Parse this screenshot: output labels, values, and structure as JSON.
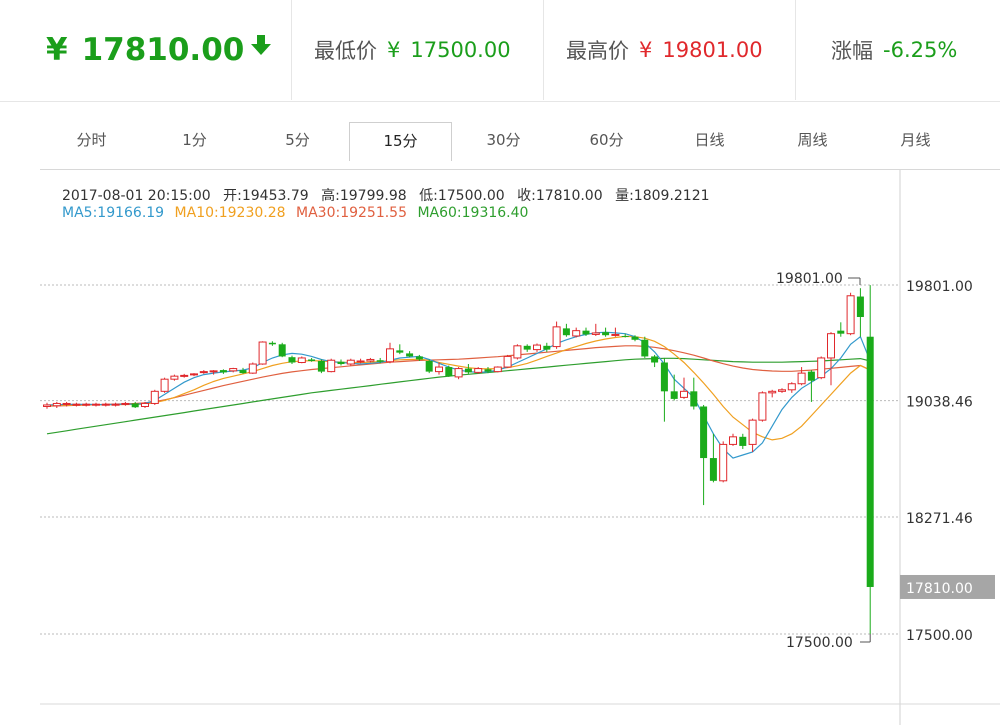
{
  "header": {
    "currency": "¥",
    "current_price": "17810.00",
    "current_direction": "down",
    "low_label": "最低价",
    "low_currency": "¥",
    "low_price": "17500.00",
    "high_label": "最高价",
    "high_currency": "¥",
    "high_price": "19801.00",
    "change_label": "涨幅",
    "change_value": "-6.25%"
  },
  "tabs": [
    {
      "label": "分时",
      "active": false
    },
    {
      "label": "1分",
      "active": false
    },
    {
      "label": "5分",
      "active": false
    },
    {
      "label": "15分",
      "active": true
    },
    {
      "label": "30分",
      "active": false
    },
    {
      "label": "60分",
      "active": false
    },
    {
      "label": "日线",
      "active": false
    },
    {
      "label": "周线",
      "active": false
    },
    {
      "label": "月线",
      "active": false
    }
  ],
  "info": {
    "datetime": "2017-08-01 20:15:00",
    "open": "开:19453.79",
    "high": "高:19799.98",
    "low": "低:17500.00",
    "close": "收:17810.00",
    "volume": "量:1809.2121"
  },
  "ma_legend": {
    "ma5": "MA5:19166.19",
    "ma10": "MA10:19230.28",
    "ma30": "MA30:19251.55",
    "ma60": "MA60:19316.40"
  },
  "colors": {
    "up": "#e0282c",
    "down": "#1aab1a",
    "ma5": "#3399cc",
    "ma10": "#f0a020",
    "ma30": "#e06040",
    "ma60": "#2e9e2e",
    "grid": "#bbbbbb"
  },
  "chart_data": {
    "type": "candlestick",
    "y_axis_ticks": [
      "19801.00",
      "19038.46",
      "18271.46",
      "17500.00"
    ],
    "ylim": [
      17300,
      20080
    ],
    "current_price_label": "17810.00",
    "annotations": {
      "max": "19801.00",
      "min": "17500.00"
    },
    "candles": [
      [
        19000,
        19010,
        18985,
        19025
      ],
      [
        19005,
        19020,
        18990,
        19030
      ],
      [
        19015,
        19020,
        19000,
        19030
      ],
      [
        19010,
        19015,
        19000,
        19025
      ],
      [
        19010,
        19015,
        19000,
        19025
      ],
      [
        19010,
        19015,
        19000,
        19025
      ],
      [
        19010,
        19015,
        19000,
        19025
      ],
      [
        19010,
        19015,
        19000,
        19025
      ],
      [
        19015,
        19020,
        19005,
        19030
      ],
      [
        19020,
        18995,
        18990,
        19030
      ],
      [
        19000,
        19020,
        18990,
        19030
      ],
      [
        19020,
        19100,
        19010,
        19110
      ],
      [
        19100,
        19180,
        19090,
        19190
      ],
      [
        19180,
        19200,
        19170,
        19210
      ],
      [
        19200,
        19205,
        19190,
        19215
      ],
      [
        19210,
        19215,
        19200,
        19220
      ],
      [
        19225,
        19230,
        19215,
        19240
      ],
      [
        19230,
        19235,
        19210,
        19240
      ],
      [
        19240,
        19225,
        19215,
        19245
      ],
      [
        19235,
        19250,
        19225,
        19255
      ],
      [
        19240,
        19220,
        19215,
        19255
      ],
      [
        19220,
        19280,
        19215,
        19290
      ],
      [
        19280,
        19425,
        19275,
        19430
      ],
      [
        19420,
        19410,
        19400,
        19430
      ],
      [
        19410,
        19330,
        19325,
        19420
      ],
      [
        19325,
        19290,
        19280,
        19335
      ],
      [
        19290,
        19320,
        19285,
        19330
      ],
      [
        19310,
        19300,
        19295,
        19320
      ],
      [
        19300,
        19230,
        19220,
        19310
      ],
      [
        19230,
        19305,
        19225,
        19315
      ],
      [
        19295,
        19280,
        19270,
        19310
      ],
      [
        19280,
        19305,
        19270,
        19315
      ],
      [
        19295,
        19300,
        19285,
        19315
      ],
      [
        19300,
        19310,
        19290,
        19320
      ],
      [
        19305,
        19295,
        19285,
        19320
      ],
      [
        19295,
        19380,
        19285,
        19420
      ],
      [
        19370,
        19355,
        19345,
        19410
      ],
      [
        19350,
        19330,
        19325,
        19365
      ],
      [
        19330,
        19310,
        19300,
        19340
      ],
      [
        19300,
        19230,
        19220,
        19310
      ],
      [
        19230,
        19260,
        19210,
        19290
      ],
      [
        19260,
        19200,
        19195,
        19270
      ],
      [
        19195,
        19250,
        19180,
        19260
      ],
      [
        19250,
        19225,
        19215,
        19280
      ],
      [
        19225,
        19250,
        19215,
        19260
      ],
      [
        19245,
        19230,
        19220,
        19260
      ],
      [
        19230,
        19260,
        19225,
        19265
      ],
      [
        19260,
        19330,
        19255,
        19340
      ],
      [
        19320,
        19400,
        19310,
        19410
      ],
      [
        19400,
        19375,
        19360,
        19410
      ],
      [
        19375,
        19405,
        19360,
        19415
      ],
      [
        19400,
        19375,
        19360,
        19420
      ],
      [
        19395,
        19525,
        19380,
        19560
      ],
      [
        19515,
        19470,
        19460,
        19545
      ],
      [
        19465,
        19500,
        19455,
        19520
      ],
      [
        19500,
        19475,
        19465,
        19520
      ],
      [
        19475,
        19485,
        19465,
        19545
      ],
      [
        19490,
        19470,
        19460,
        19520
      ],
      [
        19470,
        19475,
        19460,
        19520
      ],
      [
        19465,
        19460,
        19455,
        19480
      ],
      [
        19460,
        19440,
        19430,
        19470
      ],
      [
        19440,
        19330,
        19320,
        19460
      ],
      [
        19330,
        19290,
        19260,
        19340
      ],
      [
        19290,
        19100,
        18900,
        19320
      ],
      [
        19100,
        19050,
        19040,
        19210
      ],
      [
        19060,
        19100,
        19050,
        19190
      ],
      [
        19100,
        19000,
        18980,
        19190
      ],
      [
        19000,
        18660,
        18350,
        19010
      ],
      [
        18660,
        18510,
        18500,
        18820
      ],
      [
        18510,
        18750,
        18500,
        18770
      ],
      [
        18750,
        18800,
        18740,
        18820
      ],
      [
        18800,
        18740,
        18720,
        18820
      ],
      [
        18750,
        18910,
        18700,
        18920
      ],
      [
        18910,
        19090,
        18900,
        19100
      ],
      [
        19090,
        19100,
        19060,
        19110
      ],
      [
        19100,
        19110,
        19090,
        19120
      ],
      [
        19110,
        19150,
        19090,
        19160
      ],
      [
        19150,
        19220,
        19140,
        19260
      ],
      [
        19230,
        19170,
        19030,
        19240
      ],
      [
        19190,
        19320,
        19180,
        19330
      ],
      [
        19320,
        19480,
        19140,
        19490
      ],
      [
        19500,
        19480,
        19460,
        19555
      ],
      [
        19480,
        19730,
        19470,
        19750
      ],
      [
        19725,
        19590,
        19460,
        19780
      ],
      [
        19460,
        17810,
        17500,
        19800
      ]
    ],
    "ma5": [
      19010,
      19012,
      19014,
      19014,
      19014,
      19013,
      19012,
      19014,
      19016,
      19016,
      19020,
      19040,
      19080,
      19120,
      19160,
      19190,
      19210,
      19220,
      19228,
      19234,
      19240,
      19255,
      19290,
      19320,
      19340,
      19350,
      19345,
      19330,
      19310,
      19295,
      19290,
      19285,
      19280,
      19285,
      19290,
      19305,
      19320,
      19325,
      19330,
      19310,
      19285,
      19260,
      19240,
      19230,
      19225,
      19228,
      19240,
      19260,
      19290,
      19320,
      19350,
      19380,
      19415,
      19440,
      19460,
      19475,
      19485,
      19490,
      19485,
      19480,
      19460,
      19420,
      19360,
      19280,
      19180,
      19120,
      19060,
      18940,
      18820,
      18720,
      18660,
      18680,
      18700,
      18760,
      18870,
      18980,
      19060,
      19120,
      19160,
      19200,
      19250,
      19320,
      19410,
      19460,
      19300
    ],
    "ma10": [
      19005,
      19007,
      19008,
      19009,
      19010,
      19011,
      19011,
      19012,
      19013,
      19014,
      19015,
      19025,
      19040,
      19060,
      19085,
      19110,
      19140,
      19165,
      19185,
      19200,
      19215,
      19230,
      19250,
      19270,
      19285,
      19295,
      19300,
      19302,
      19300,
      19296,
      19292,
      19290,
      19290,
      19292,
      19296,
      19302,
      19308,
      19310,
      19312,
      19305,
      19290,
      19278,
      19266,
      19256,
      19250,
      19248,
      19250,
      19256,
      19268,
      19284,
      19306,
      19330,
      19352,
      19375,
      19395,
      19415,
      19432,
      19445,
      19455,
      19462,
      19460,
      19450,
      19430,
      19395,
      19345,
      19290,
      19225,
      19155,
      19080,
      19000,
      18930,
      18880,
      18830,
      18800,
      18780,
      18790,
      18820,
      18870,
      18940,
      19010,
      19080,
      19150,
      19220,
      19270,
      19240
    ],
    "ma30": [
      19002,
      19004,
      19006,
      19008,
      19010,
      19012,
      19014,
      19016,
      19018,
      19020,
      19024,
      19032,
      19044,
      19058,
      19074,
      19090,
      19106,
      19122,
      19138,
      19152,
      19166,
      19180,
      19194,
      19206,
      19218,
      19228,
      19236,
      19244,
      19250,
      19256,
      19262,
      19268,
      19274,
      19280,
      19286,
      19292,
      19296,
      19300,
      19304,
      19306,
      19308,
      19310,
      19312,
      19316,
      19320,
      19324,
      19328,
      19334,
      19340,
      19346,
      19352,
      19358,
      19364,
      19370,
      19376,
      19382,
      19388,
      19392,
      19396,
      19400,
      19400,
      19396,
      19390,
      19380,
      19368,
      19354,
      19338,
      19320,
      19300,
      19282,
      19266,
      19254,
      19244,
      19238,
      19234,
      19232,
      19232,
      19236,
      19240,
      19246,
      19252,
      19258,
      19264,
      19270,
      19240
    ],
    "ma60": [
      18820,
      18830,
      18840,
      18850,
      18860,
      18870,
      18880,
      18890,
      18900,
      18910,
      18920,
      18930,
      18940,
      18950,
      18960,
      18970,
      18980,
      18990,
      19000,
      19010,
      19020,
      19030,
      19040,
      19050,
      19060,
      19070,
      19080,
      19090,
      19098,
      19106,
      19114,
      19122,
      19130,
      19138,
      19146,
      19154,
      19162,
      19170,
      19178,
      19186,
      19194,
      19200,
      19206,
      19212,
      19218,
      19224,
      19230,
      19236,
      19242,
      19248,
      19254,
      19260,
      19266,
      19272,
      19278,
      19284,
      19290,
      19296,
      19302,
      19308,
      19312,
      19314,
      19316,
      19318,
      19318,
      19316,
      19312,
      19308,
      19304,
      19300,
      19296,
      19294,
      19292,
      19292,
      19292,
      19292,
      19294,
      19296,
      19298,
      19300,
      19304,
      19308,
      19312,
      19316,
      19300
    ]
  }
}
